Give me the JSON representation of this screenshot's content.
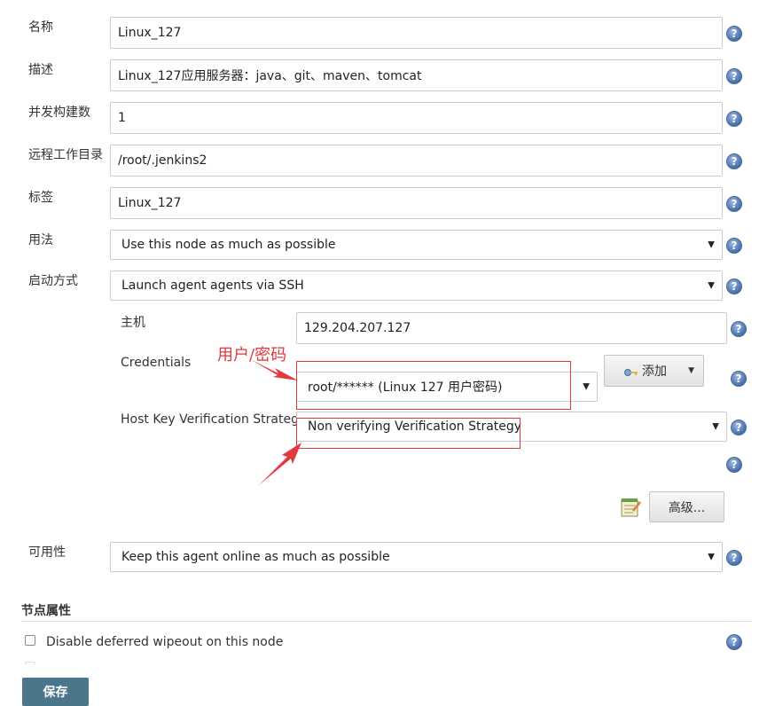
{
  "form": {
    "name": {
      "label": "名称",
      "value": "Linux_127"
    },
    "description": {
      "label": "描述",
      "value": "Linux_127应用服务器：java、git、maven、tomcat"
    },
    "executors": {
      "label": "并发构建数",
      "value": "1"
    },
    "remote_dir": {
      "label": "远程工作目录",
      "value": "/root/.jenkins2"
    },
    "labels": {
      "label": "标签",
      "value": "Linux_127"
    },
    "usage": {
      "label": "用法",
      "value": "Use this node as much as possible"
    },
    "launch": {
      "label": "启动方式",
      "value": "Launch agent agents via SSH"
    },
    "host": {
      "label": "主机",
      "value": "129.204.207.127"
    },
    "credentials": {
      "label": "Credentials",
      "value": "root/****** (Linux  127 用户密码)",
      "add_label": "添加"
    },
    "host_key": {
      "label": "Host Key Verification Strategy",
      "value": "Non verifying Verification Strategy"
    },
    "advanced_label": "高级...",
    "availability": {
      "label": "可用性",
      "value": "Keep this agent online as much as possible"
    }
  },
  "node_properties": {
    "title": "节点属性",
    "disable_wipeout_label": "Disable deferred wipeout on this node"
  },
  "annotation": {
    "text": "用户/密码"
  },
  "save_label": "保存",
  "colors": {
    "annotation_red": "#e0393e",
    "save_bg": "#4b758b"
  },
  "icons": {
    "help": "help-icon",
    "dropdown": "chevron-down-icon",
    "notepad": "notepad-icon",
    "key": "key-icon"
  }
}
